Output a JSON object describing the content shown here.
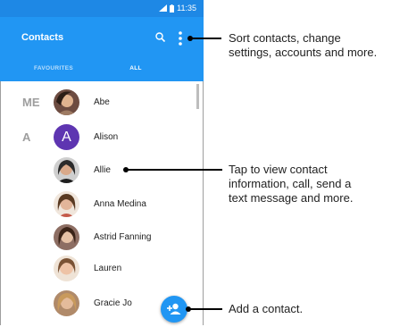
{
  "status_bar": {
    "time": "11:35"
  },
  "app_bar": {
    "title": "Contacts"
  },
  "tabs": [
    {
      "label": "FAVOURITES",
      "selected": false
    },
    {
      "label": "ALL",
      "selected": true
    }
  ],
  "contacts": [
    {
      "section": "ME",
      "name": "Abe",
      "avatar": "photo"
    },
    {
      "section": "A",
      "name": "Alison",
      "avatar": "letter",
      "letter": "A",
      "avatar_color": "#5e35b1"
    },
    {
      "section": "",
      "name": "Allie",
      "avatar": "photo"
    },
    {
      "section": "",
      "name": "Anna Medina",
      "avatar": "photo"
    },
    {
      "section": "",
      "name": "Astrid Fanning",
      "avatar": "photo"
    },
    {
      "section": "",
      "name": "Lauren",
      "avatar": "photo"
    },
    {
      "section": "",
      "name": "Gracie Jo",
      "avatar": "photo"
    }
  ],
  "fab": {
    "icon": "add-contact-icon"
  },
  "callouts": [
    {
      "text_line1": "Sort contacts, change",
      "text_line2": "settings, accounts and more."
    },
    {
      "text_line1": "Tap to view contact",
      "text_line2": "information, call, send a",
      "text_line3": "text message and more."
    },
    {
      "text_line1": "Add a contact."
    }
  ],
  "colors": {
    "primary": "#2196f3",
    "status_bar": "#1e88e5",
    "avatar_letter": "#5e35b1"
  }
}
